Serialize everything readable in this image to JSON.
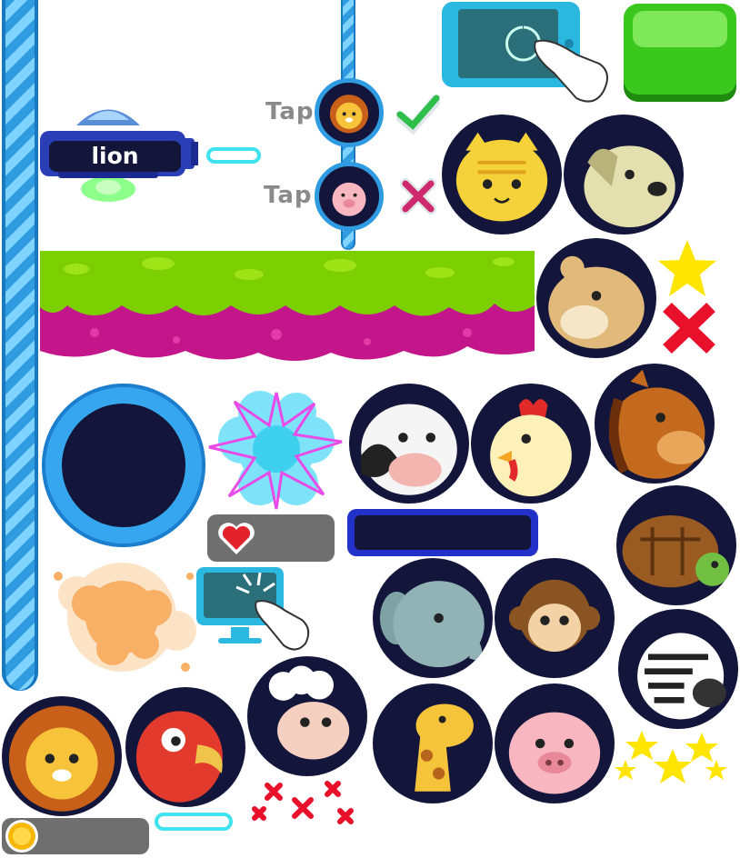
{
  "word_panel": {
    "word": "lion"
  },
  "tap_row_1": {
    "label": "Tap",
    "animal": "lion",
    "result": "correct-checkmark"
  },
  "tap_row_2": {
    "label": "Tap",
    "animal": "pig",
    "result": "wrong-cross"
  },
  "animals": [
    "cat",
    "dog",
    "hamster",
    "cow",
    "chicken",
    "horse",
    "turtle",
    "elephant",
    "monkey",
    "zebra",
    "lion",
    "parrot",
    "sheep",
    "giraffe",
    "pig"
  ],
  "colors": {
    "circle_bg": "#13163a",
    "pole_blue": "#2f9be0",
    "slime_green": "#7ccf00",
    "goo_magenta": "#c2168a",
    "green_button": "#3bc81e",
    "star_yellow": "#ffe500",
    "cross_red": "#e8102a",
    "cross_pink": "#d0286c",
    "heart_red": "#e2232c",
    "coin_gold": "#f5b700",
    "splash_orange": "#f8b066",
    "burst_cyan": "#3fd0f0",
    "bar_gray": "#6f6f6f",
    "bar_blue": "#2231c8",
    "pill_cyan": "#3fe3f0"
  },
  "icons": [
    "tablet-touch-icon",
    "green-button-icon",
    "checkmark-icon",
    "cross-icon",
    "star-icon",
    "heart-icon",
    "coin-icon",
    "monitor-touch-icon",
    "explosion-icon",
    "splash-icon",
    "black-hole-icon",
    "spaceship-icon",
    "stars-cluster-icon",
    "crosses-cluster-icon"
  ]
}
